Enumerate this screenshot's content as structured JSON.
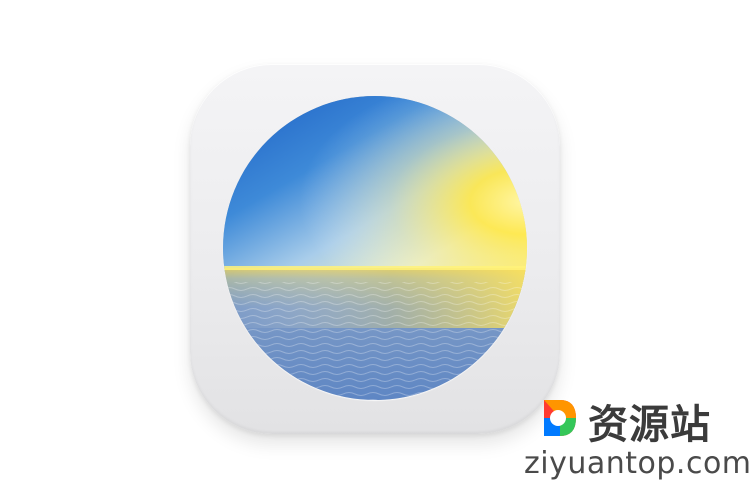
{
  "icon": {
    "name": "sunset-ocean-app-icon",
    "colors": {
      "sky_top": "#1f6fd1",
      "sky_mid": "#7fb3e8",
      "horizon_glow": "#ffe84a",
      "sea": "#6e93c9",
      "frame": "#eeeef0"
    }
  },
  "watermark": {
    "site_name": "资源站",
    "domain": "ziyuantop.com",
    "logo_colors": [
      "#ff3b30",
      "#ff9500",
      "#34c759",
      "#007aff"
    ]
  }
}
